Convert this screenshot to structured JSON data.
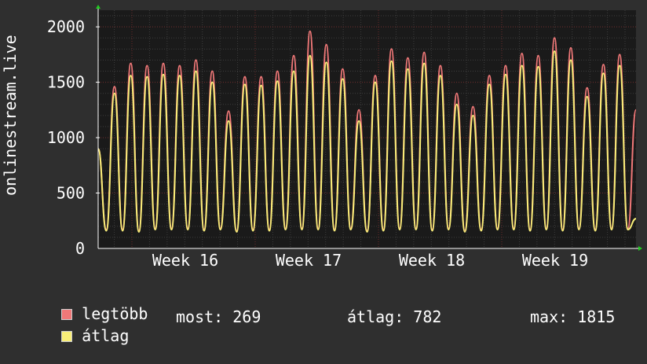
{
  "chart_data": {
    "type": "line",
    "ylabel": "onlinestream.live",
    "ylim": [
      0,
      2150
    ],
    "yticks": [
      0,
      500,
      1000,
      1500,
      2000
    ],
    "x_ticks": [
      "Week 16",
      "Week 17",
      "Week 18",
      "Week 19"
    ],
    "grid": true,
    "legend_position": "bottom-left",
    "colors": {
      "background": "#2f2f2f",
      "plot_bg": "#1a1a1a",
      "grid_minor": "#3d3d3d",
      "grid_major": "#6b2a2a",
      "axis": "#ffffff",
      "series_max": "#f07878",
      "series_avg": "#f8ee78"
    },
    "series": [
      {
        "name": "legtöbb",
        "color": "#f07878",
        "values": [
          900,
          170,
          1460,
          170,
          1670,
          160,
          1650,
          180,
          1670,
          180,
          1650,
          180,
          1700,
          170,
          1600,
          180,
          1240,
          160,
          1550,
          170,
          1550,
          170,
          1600,
          180,
          1740,
          180,
          1960,
          180,
          1840,
          170,
          1620,
          180,
          1250,
          160,
          1560,
          170,
          1800,
          180,
          1720,
          180,
          1770,
          170,
          1650,
          180,
          1400,
          160,
          1280,
          170,
          1560,
          180,
          1650,
          180,
          1760,
          170,
          1740,
          180,
          1900,
          170,
          1810,
          180,
          1450,
          170,
          1660,
          180,
          1750,
          180,
          1250
        ]
      },
      {
        "name": "átlag",
        "color": "#f8ee78",
        "values": [
          900,
          160,
          1400,
          160,
          1560,
          150,
          1550,
          170,
          1570,
          170,
          1560,
          170,
          1600,
          160,
          1500,
          170,
          1150,
          150,
          1480,
          160,
          1470,
          160,
          1510,
          170,
          1600,
          170,
          1740,
          170,
          1680,
          160,
          1530,
          170,
          1150,
          150,
          1500,
          160,
          1690,
          170,
          1620,
          170,
          1670,
          160,
          1560,
          170,
          1300,
          150,
          1200,
          160,
          1480,
          170,
          1570,
          170,
          1650,
          160,
          1640,
          170,
          1780,
          160,
          1700,
          170,
          1370,
          160,
          1580,
          170,
          1650,
          170,
          269
        ]
      }
    ]
  },
  "legend": [
    {
      "label": "legtöbb",
      "color": "#f07878"
    },
    {
      "label": "átlag",
      "color": "#f8ee78"
    }
  ],
  "stats": {
    "current": "most: 269",
    "average": "átlag: 782",
    "max": "max: 1815"
  }
}
